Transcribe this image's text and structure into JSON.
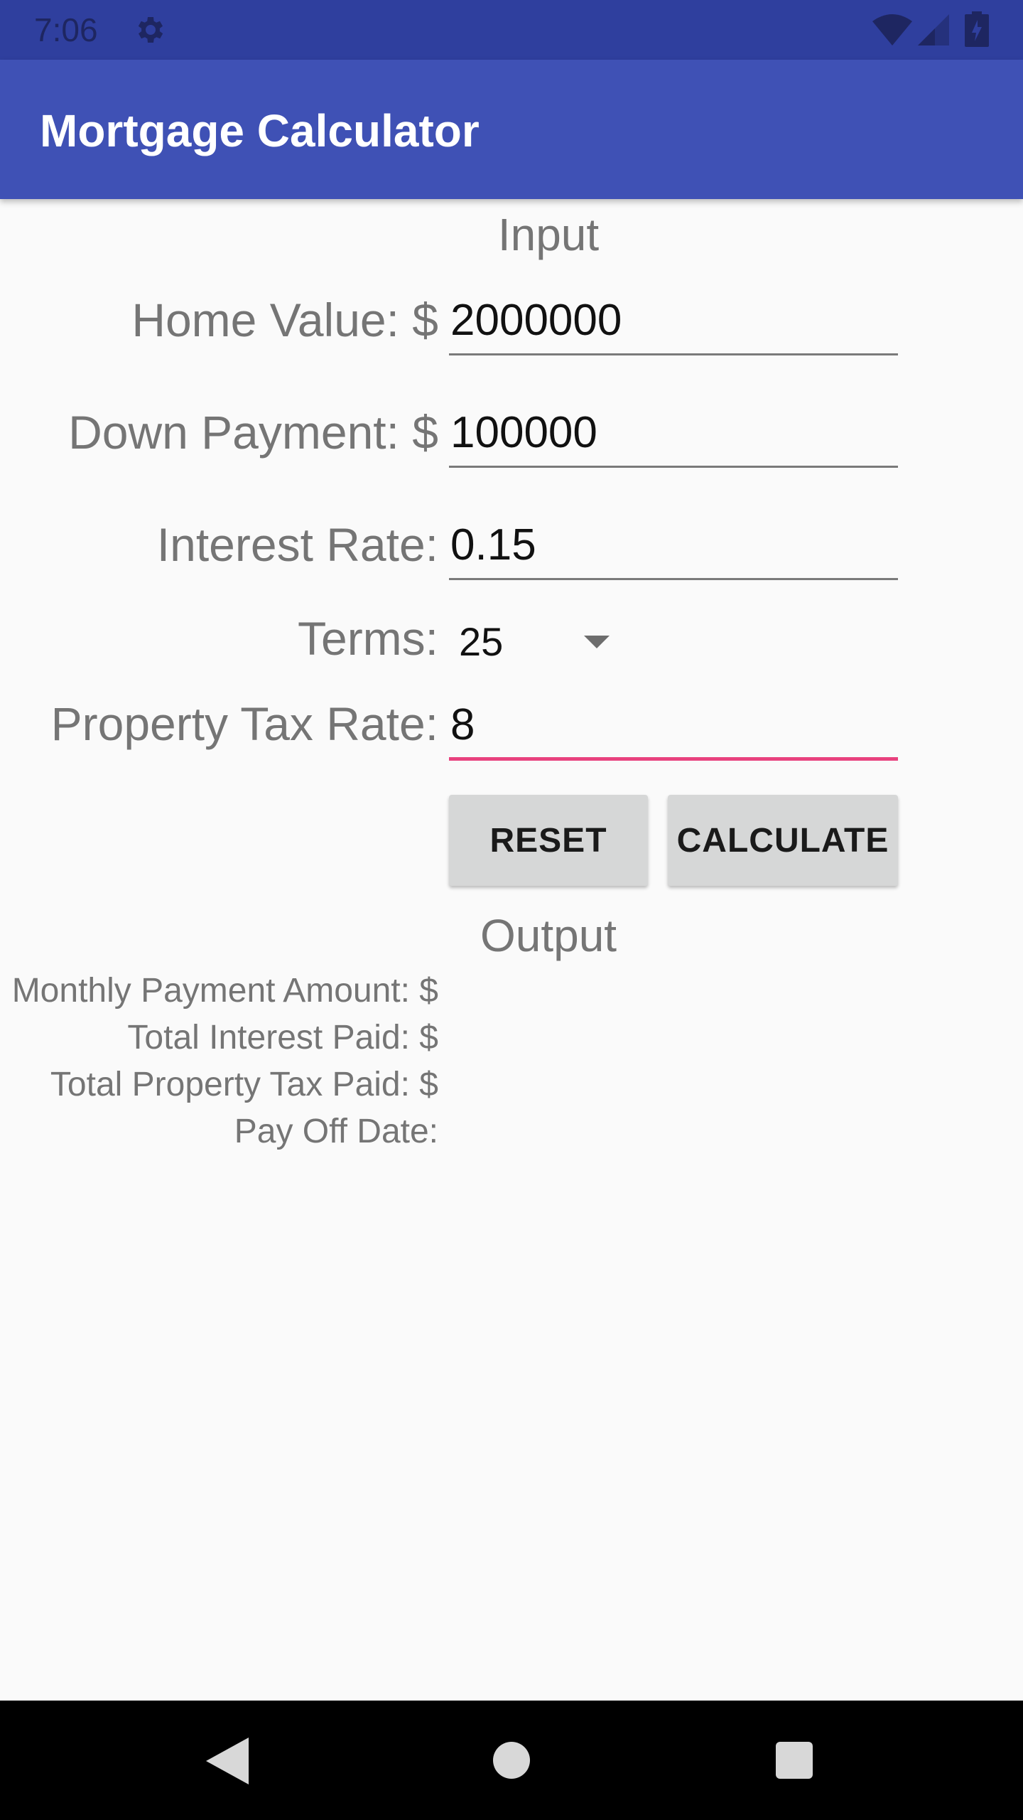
{
  "status_bar": {
    "time": "7:06",
    "icons": [
      "gear-icon",
      "wifi-icon",
      "signal-icon",
      "battery-icon"
    ]
  },
  "app_bar": {
    "title": "Mortgage Calculator",
    "color": "#3f51b5"
  },
  "input_section": {
    "title": "Input",
    "home_value": {
      "label": "Home Value: $",
      "value": "2000000"
    },
    "down_payment": {
      "label": "Down Payment: $",
      "value": "100000"
    },
    "interest_rate": {
      "label": "Interest Rate:",
      "value": "0.15"
    },
    "terms": {
      "label": "Terms:",
      "selected": "25"
    },
    "property_tax_rate": {
      "label": "Property Tax Rate:",
      "value": "8"
    },
    "focus_color": "#e8417e"
  },
  "buttons": {
    "reset": "RESET",
    "calculate": "CALCULATE"
  },
  "output_section": {
    "title": "Output",
    "monthly_payment": "Monthly Payment Amount: $",
    "total_interest": "Total Interest Paid: $",
    "total_property_tax": "Total Property Tax Paid: $",
    "pay_off_date": "Pay Off Date:"
  },
  "nav_bar": {
    "icons": [
      "back-icon",
      "home-icon",
      "recents-icon"
    ]
  }
}
